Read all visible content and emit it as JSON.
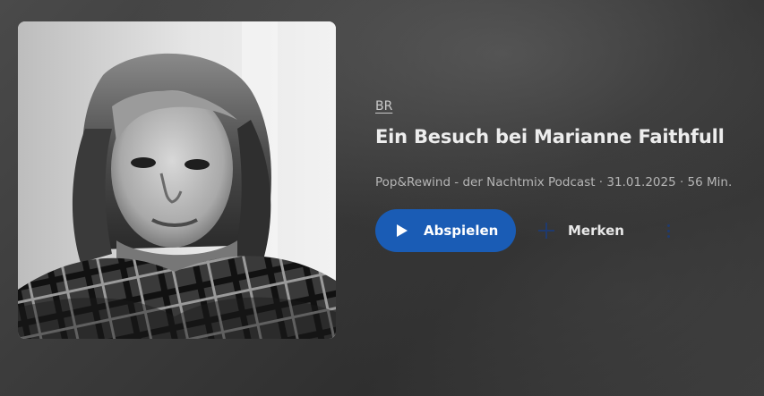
{
  "episode": {
    "broadcaster": "BR",
    "title": "Ein Besuch bei Marianne Faithfull",
    "meta": "Pop&Rewind - der Nachtmix Podcast · 31.01.2025 · 56 Min.",
    "cover_icon": "portrait-photo"
  },
  "actions": {
    "play_label": "Abspielen",
    "save_label": "Merken",
    "play_icon": "play-icon",
    "save_icon": "plus-icon",
    "more_icon": "more-vertical-icon"
  },
  "colors": {
    "play_button": "#1a5cb5",
    "icon_dark_blue": "#1f3a6e"
  }
}
